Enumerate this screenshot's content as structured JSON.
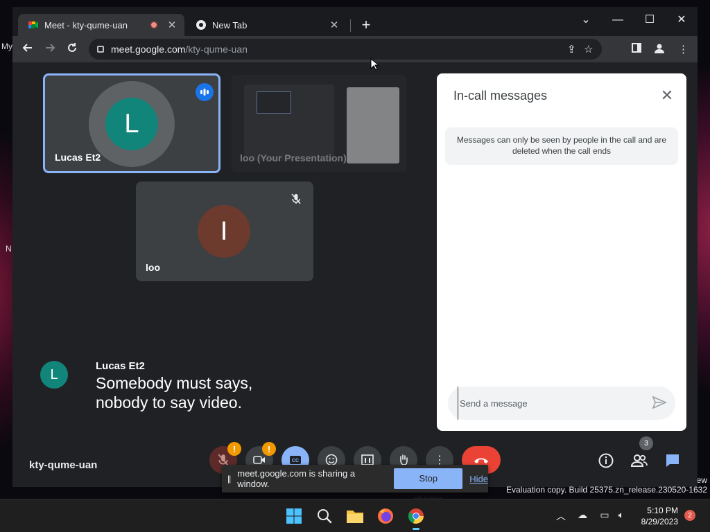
{
  "desktop": {
    "left_fragments": [
      "My",
      "N"
    ],
    "right_fragment": "ew"
  },
  "browser": {
    "tabs": [
      {
        "title": "Meet - kty-qume-uan",
        "active": true
      },
      {
        "title": "New Tab",
        "active": false
      }
    ],
    "new_tab_icon": "+",
    "window_controls": {
      "minimize": "—",
      "maximize": "☐",
      "close": "✕",
      "tab_search": "⌄"
    },
    "url": {
      "host": "meet.google.com",
      "path": "/kty-qume-uan"
    }
  },
  "meet": {
    "participants": [
      {
        "name": "Lucas Et2",
        "initial": "L",
        "speaking": true,
        "avatar_color": "#12857a"
      },
      {
        "name": "loo (Your Presentation)",
        "presentation": true
      },
      {
        "name": "loo",
        "initial": "I",
        "muted": true,
        "avatar_color": "#6d3a2e"
      }
    ],
    "caption": {
      "speaker": "Lucas Et2",
      "initial": "L",
      "lines": [
        "Somebody must says,",
        "nobody to say video."
      ]
    },
    "meeting_code": "kty-qume-uan",
    "participant_count": "3",
    "chat": {
      "title": "In-call messages",
      "notice": "Messages can only be seen by people in the call and are deleted when the call ends",
      "input_placeholder": "Send a message"
    },
    "share_bar": {
      "grip": "||",
      "text": "meet.google.com is sharing a window.",
      "stop_label": "Stop sharing",
      "hide_label": "Hide"
    },
    "colors": {
      "accent": "#8ab4f8",
      "end_call": "#ea4335",
      "warning": "#f29900"
    }
  },
  "system": {
    "eval_line1": "Evaluation copy. Build 25375.zn_release.230520-1632",
    "time": "5:10 PM",
    "date": "8/29/2023",
    "notifications": "2"
  }
}
